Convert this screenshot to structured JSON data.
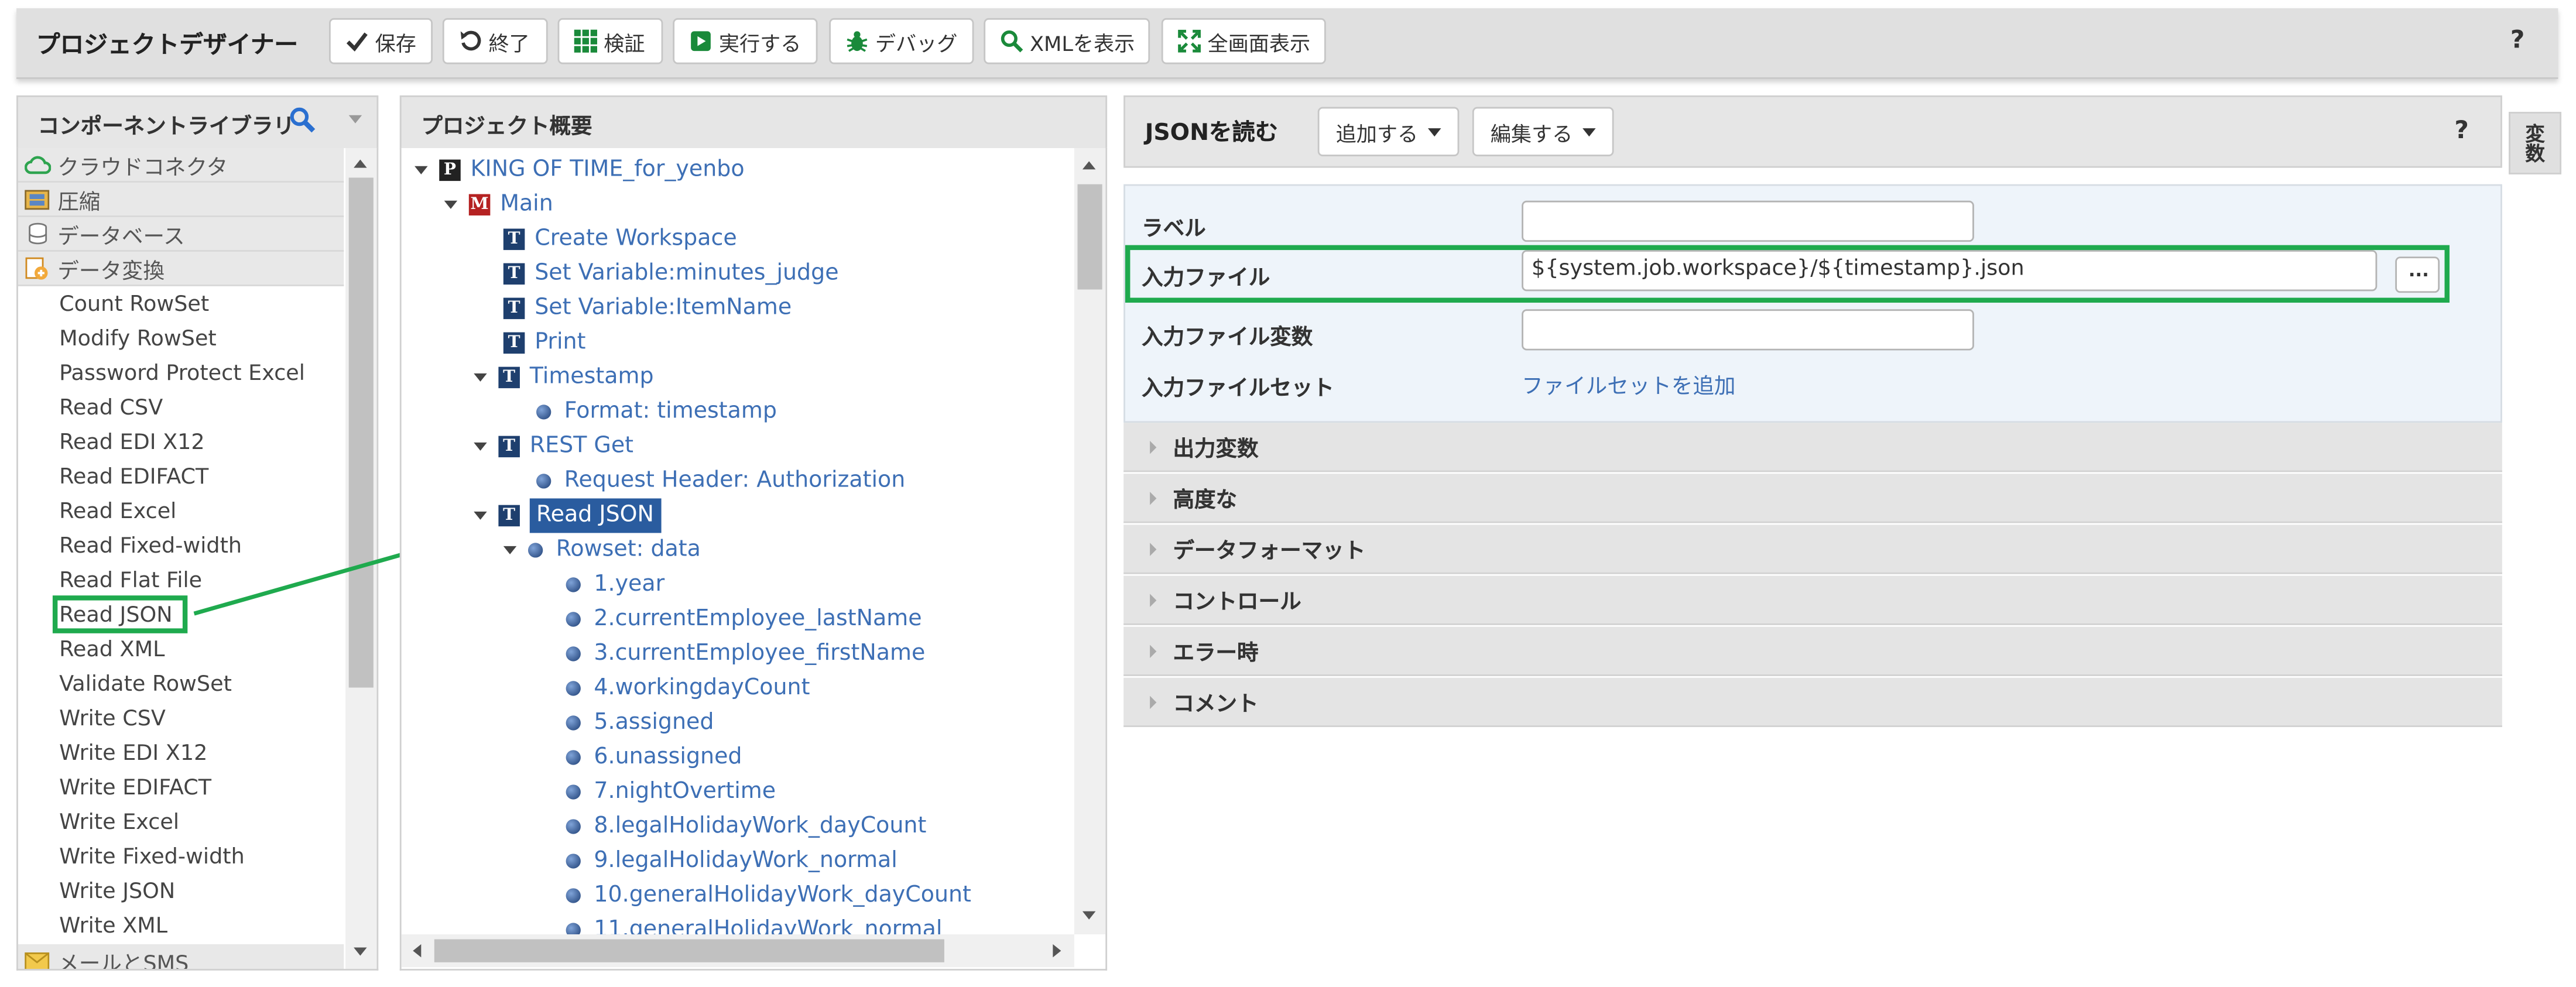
{
  "toolbar": {
    "title": "プロジェクトデザイナー",
    "save": "保存",
    "close": "終了",
    "validate": "検証",
    "run": "実行する",
    "debug": "デバッグ",
    "xml": "XMLを表示",
    "fullscreen": "全画面表示",
    "help": "?"
  },
  "library": {
    "title": "コンポーネントライブラリ",
    "categories": [
      "クラウドコネクタ",
      "圧縮",
      "データベース",
      "データ変換"
    ],
    "items": [
      "Count RowSet",
      "Modify RowSet",
      "Password Protect Excel",
      "Read CSV",
      "Read EDI X12",
      "Read EDIFACT",
      "Read Excel",
      "Read Fixed-width",
      "Read Flat File",
      "Read JSON",
      "Read XML",
      "Validate RowSet",
      "Write CSV",
      "Write EDI X12",
      "Write EDIFACT",
      "Write Excel",
      "Write Fixed-width",
      "Write JSON",
      "Write XML"
    ],
    "bottom_category": "メールとSMS"
  },
  "project": {
    "title": "プロジェクト概要",
    "nodes": [
      "KING OF TIME_for_yenbo",
      "Main",
      "Create Workspace",
      "Set Variable:minutes_judge",
      "Set Variable:ItemName",
      "Print",
      "Timestamp",
      "Format: timestamp",
      "REST Get",
      "Request Header: Authorization",
      "Read JSON",
      "Rowset: data",
      "1.year",
      "2.currentEmployee_lastName",
      "3.currentEmployee_firstName",
      "4.workingdayCount",
      "5.assigned",
      "6.unassigned",
      "7.nightOvertime",
      "8.legalHolidayWork_dayCount",
      "9.legalHolidayWork_normal",
      "10.generalHolidayWork_dayCount",
      "11.generalHolidayWork_normal"
    ]
  },
  "props": {
    "title": "JSONを読む",
    "add": "追加する",
    "edit": "編集する",
    "help": "?",
    "label": "ラベル",
    "label_value": "",
    "input_file": "入力ファイル",
    "input_file_value": "${system.job.workspace}/${timestamp}.json",
    "browse": "...",
    "input_file_var": "入力ファイル変数",
    "input_file_var_value": "",
    "input_fileset": "入力ファイルセット",
    "add_fileset": "ファイルセットを追加",
    "sections": [
      "出力変数",
      "高度な",
      "データフォーマット",
      "コントロール",
      "エラー時",
      "コメント"
    ]
  },
  "side_tab": "変数",
  "colors": {
    "highlight": "#1faa4e",
    "link": "#3d6fb5",
    "selected": "#2a5c9f",
    "icon_green": "#1a8a3a"
  }
}
